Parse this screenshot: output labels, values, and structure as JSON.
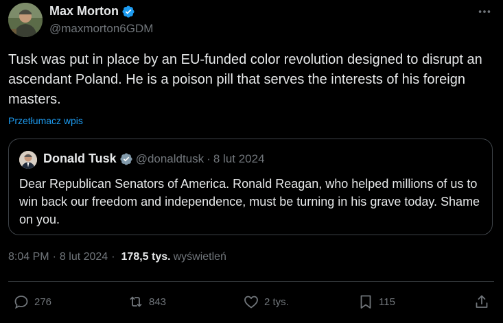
{
  "post": {
    "author": {
      "name": "Max Morton",
      "handle": "@maxmorton6GDM",
      "verified": true,
      "avatar_icon": "profile-photo-icon"
    },
    "text": "Tusk was put in place by an EU-funded color revolution designed to disrupt an ascendant Poland. He is a poison pill that serves the interests of his foreign masters.",
    "translate_label": "Przetłumacz wpis",
    "quote": {
      "name": "Donald Tusk",
      "handle": "@donaldtusk",
      "separator": "·",
      "date": "8 lut 2024",
      "text": "Dear Republican Senators of America. Ronald Reagan, who helped millions of us to win back our freedom and independence, must be turning in his grave today. Shame on you."
    },
    "meta": {
      "time": "8:04 PM",
      "separator": "·",
      "date": "8 lut 2024",
      "views_count": "178,5 tys.",
      "views_label": "wyświetleń"
    },
    "actions": {
      "replies": "276",
      "reposts": "843",
      "likes": "2 tys.",
      "bookmarks": "115"
    }
  },
  "colors": {
    "background": "#000000",
    "text_primary": "#e7e9ea",
    "text_secondary": "#71767b",
    "accent": "#1d9bf0",
    "border": "#3f4449"
  }
}
